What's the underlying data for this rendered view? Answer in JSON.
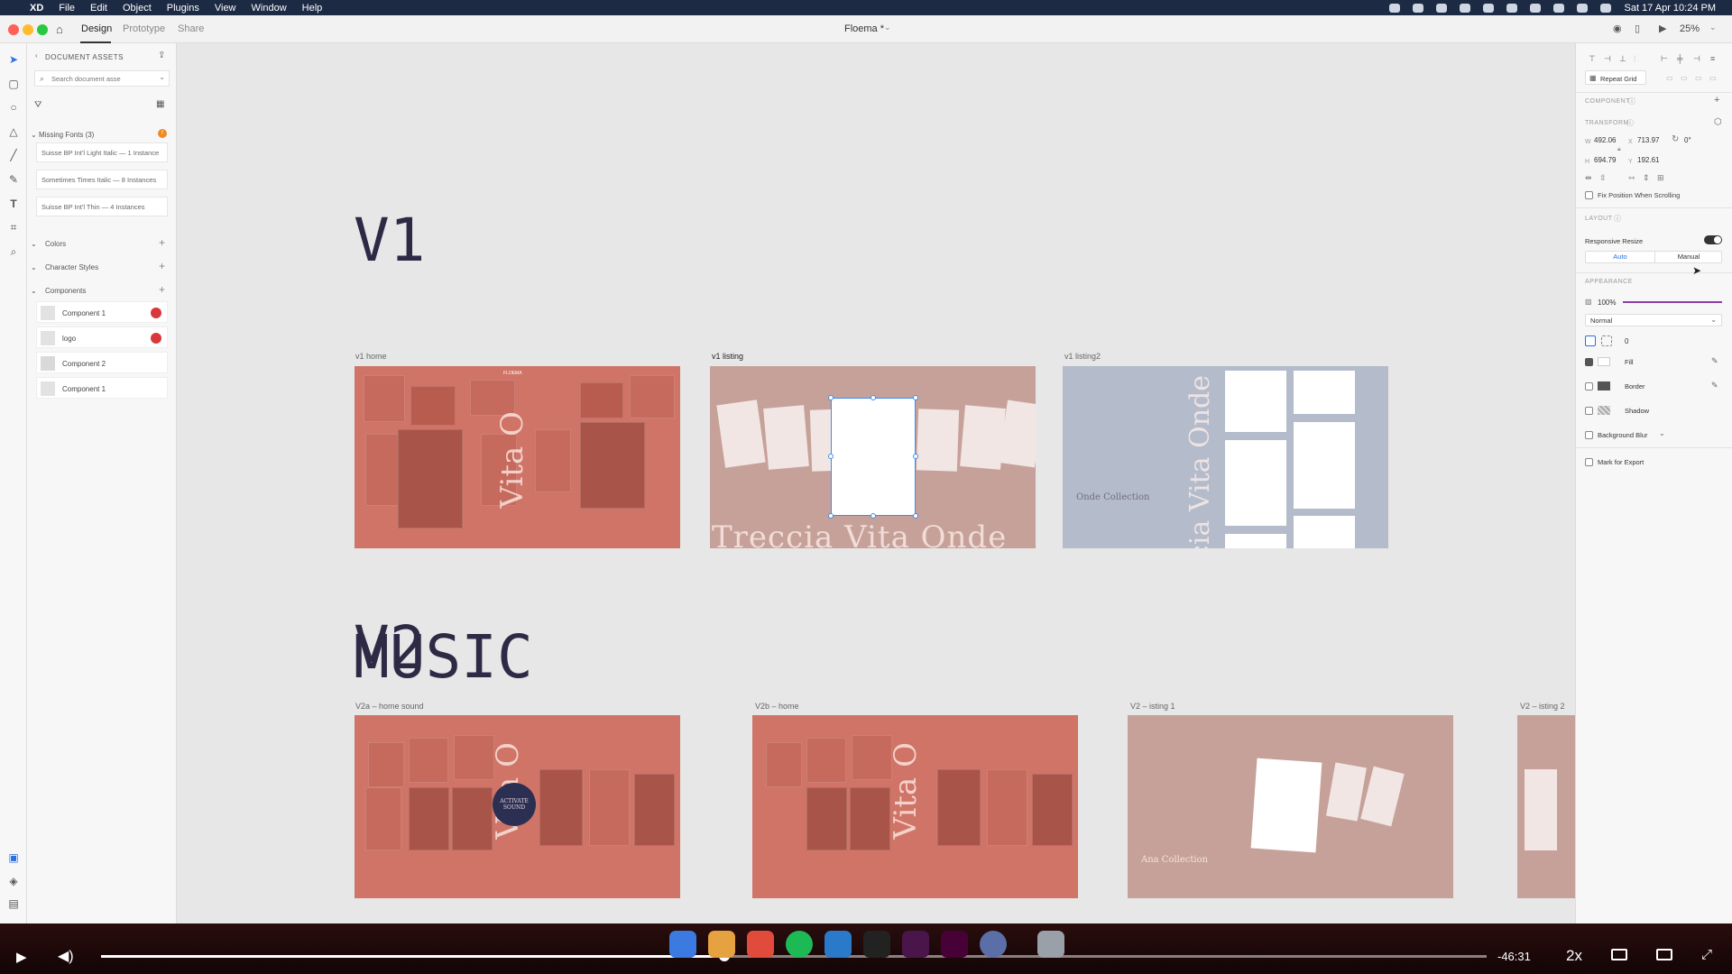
{
  "menubar": {
    "items": [
      "XD",
      "File",
      "Edit",
      "Object",
      "Plugins",
      "View",
      "Window",
      "Help"
    ],
    "datetime": "Sat 17 Apr  10:24 PM"
  },
  "titlebar": {
    "tabs": [
      "Design",
      "Prototype",
      "Share"
    ],
    "document_title": "Floema *",
    "zoom": "25%"
  },
  "assets": {
    "header": "DOCUMENT ASSETS",
    "search_placeholder": "Search document asse",
    "missing_fonts_label": "Missing Fonts (3)",
    "missing_fonts": [
      "Suisse BP Int'l Light Italic — 1 Instance",
      "Sometimes Times Italic — 8 Instances",
      "Suisse BP Int'l Thin — 4 Instances"
    ],
    "colors_label": "Colors",
    "char_styles_label": "Character Styles",
    "components_label": "Components",
    "components": [
      "Component 1",
      "logo",
      "Component 2",
      "Component 1"
    ]
  },
  "canvas": {
    "v1_title": "V1",
    "v2_title_a": "V2",
    "v2_title_b": "MUSIC",
    "artboards_row1": [
      "v1 home",
      "v1 listing",
      "v1 listing2"
    ],
    "artboards_row2": [
      "V2a – home sound",
      "V2b – home",
      "V2 – isting 1",
      "V2 – isting 2"
    ],
    "listing_text": "Treccia  Vita  Onde",
    "onde_collection": "Onde Collection",
    "ana_collection": "Ana Collection",
    "orb_text": "ACTIVATE SOUND",
    "vita_text": "Vita O",
    "floema_mark": "FLOEMA"
  },
  "inspector": {
    "repeat_grid_label": "Repeat Grid",
    "component_label": "COMPONENT",
    "transform_label": "TRANSFORM",
    "w": "492.06",
    "x": "713.97",
    "rotation": "0°",
    "h": "694.79",
    "y": "192.61",
    "fix_position_label": "Fix Position When Scrolling",
    "layout_label": "LAYOUT",
    "responsive_resize_label": "Responsive Resize",
    "responsive_resize_on": true,
    "auto_label": "Auto",
    "manual_label": "Manual",
    "appearance_label": "APPEARANCE",
    "opacity": "100%",
    "opacity_fraction": 1.0,
    "blend_mode": "Normal",
    "corner_radius": "0",
    "fill_label": "Fill",
    "fill_checked": true,
    "border_label": "Border",
    "shadow_label": "Shadow",
    "background_blur_label": "Background Blur",
    "mark_export_label": "Mark for Export"
  },
  "video": {
    "time_remaining": "-46:31",
    "speed": "2x",
    "progress_fraction": 0.45
  },
  "colors": {
    "accent": "#3f8ee8",
    "rose": "#cf7466",
    "slate": "#b4bbca",
    "title_ink": "#2e2a46",
    "warn": "#d9383a"
  }
}
